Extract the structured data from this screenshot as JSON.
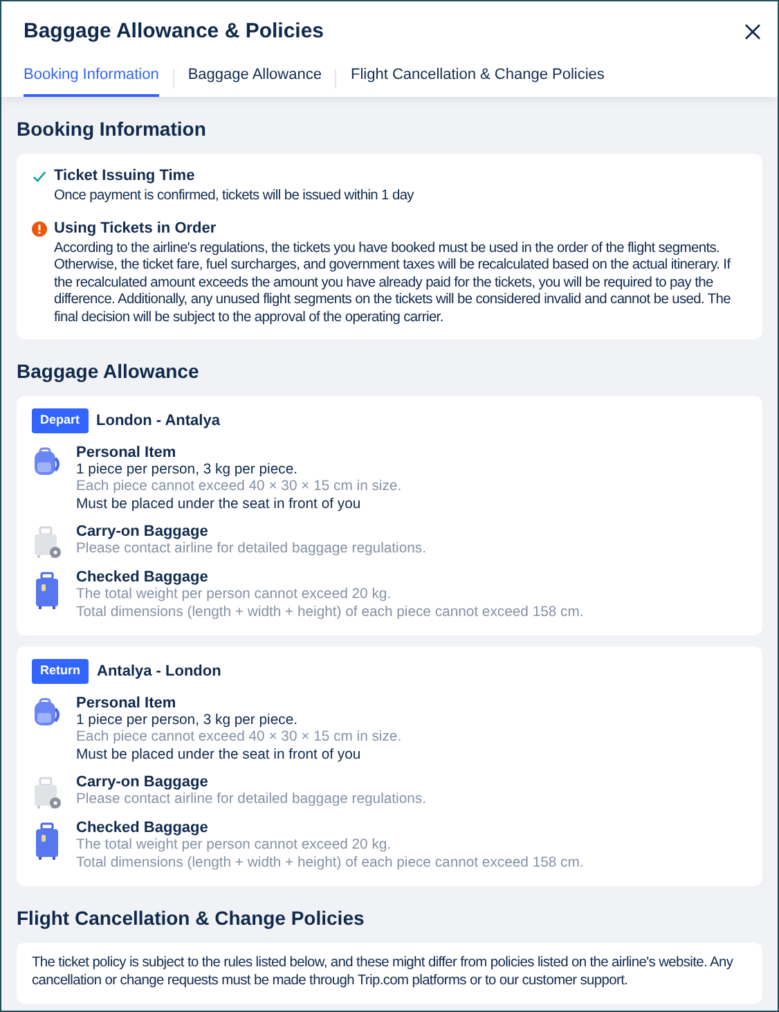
{
  "window": {
    "title": "Baggage Allowance & Policies"
  },
  "tabs": [
    {
      "label": "Booking Information",
      "selected": true
    },
    {
      "label": "Baggage Allowance",
      "selected": false
    },
    {
      "label": "Flight Cancellation & Change Policies",
      "selected": false
    }
  ],
  "booking_information": {
    "heading": "Booking Information",
    "items": [
      {
        "kind": "check",
        "title": "Ticket Issuing Time",
        "text": "Once payment is confirmed, tickets will be issued within 1 day"
      },
      {
        "kind": "warning",
        "title": "Using Tickets in Order",
        "text": "According to the airline's regulations, the tickets you have booked must be used in the order of the flight segments. Otherwise, the ticket fare, fuel surcharges, and government taxes will be recalculated based on the actual itinerary. If the recalculated amount exceeds the amount you have already paid for the tickets, you will be required to pay the difference. Additionally, any unused flight segments on the tickets will be considered invalid and cannot be used. The final decision will be subject to the approval of the operating carrier."
      }
    ]
  },
  "baggage_allowance": {
    "heading": "Baggage Allowance",
    "segments": [
      {
        "badge": "Depart",
        "route": "London - Antalya",
        "items": [
          {
            "kind": "personal",
            "title": "Personal Item",
            "lines": [
              {
                "text": "1 piece per person, 3 kg per piece.",
                "muted": false
              },
              {
                "text": "Each piece cannot exceed 40 × 30 × 15 cm in size.",
                "muted": true
              },
              {
                "text": "Must be placed under the seat in front of you",
                "muted": false
              }
            ]
          },
          {
            "kind": "carry_on",
            "title": "Carry-on Baggage",
            "lines": [
              {
                "text": "Please contact airline for detailed baggage regulations.",
                "muted": true
              }
            ]
          },
          {
            "kind": "checked",
            "title": "Checked Baggage",
            "lines": [
              {
                "text": "The total weight per person cannot exceed 20 kg.",
                "muted": true
              },
              {
                "text": "Total dimensions (length + width + height) of each piece cannot exceed 158 cm.",
                "muted": true
              }
            ]
          }
        ]
      },
      {
        "badge": "Return",
        "route": "Antalya - London",
        "items": [
          {
            "kind": "personal",
            "title": "Personal Item",
            "lines": [
              {
                "text": "1 piece per person, 3 kg per piece.",
                "muted": false
              },
              {
                "text": "Each piece cannot exceed 40 × 30 × 15 cm in size.",
                "muted": true
              },
              {
                "text": "Must be placed under the seat in front of you",
                "muted": false
              }
            ]
          },
          {
            "kind": "carry_on",
            "title": "Carry-on Baggage",
            "lines": [
              {
                "text": "Please contact airline for detailed baggage regulations.",
                "muted": true
              }
            ]
          },
          {
            "kind": "checked",
            "title": "Checked Baggage",
            "lines": [
              {
                "text": "The total weight per person cannot exceed 20 kg.",
                "muted": true
              },
              {
                "text": "Total dimensions (length + width + height) of each piece cannot exceed 158 cm.",
                "muted": true
              }
            ]
          }
        ]
      }
    ]
  },
  "cancellation_policies": {
    "heading": "Flight Cancellation & Change Policies",
    "text": "The ticket policy is subject to the rules listed below, and these might differ from policies listed on the airline's website. Any cancellation or change requests must be made through Trip.com platforms or to our customer support."
  }
}
